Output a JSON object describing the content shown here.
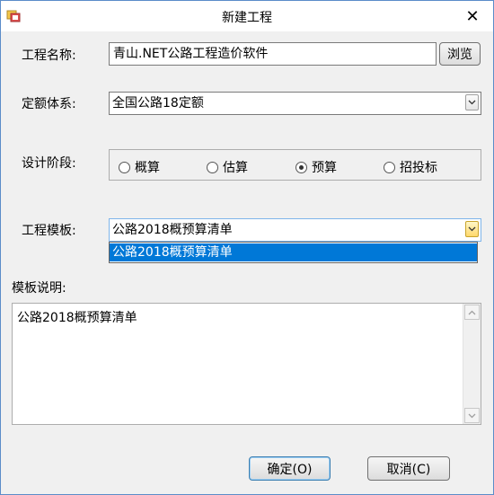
{
  "window": {
    "title": "新建工程",
    "close_glyph": "✕"
  },
  "project_name": {
    "label": "工程名称:",
    "value": "青山.NET公路工程造价软件",
    "browse_label": "浏览"
  },
  "quota_system": {
    "label": "定额体系:",
    "value": "全国公路18定额"
  },
  "design_stage": {
    "label": "设计阶段:",
    "options": [
      "概算",
      "估算",
      "预算",
      "招投标"
    ],
    "selected": "预算"
  },
  "template": {
    "label": "工程模板:",
    "value": "公路2018概预算清单",
    "dropdown_items": [
      "公路2018概预算清单"
    ]
  },
  "template_desc": {
    "label": "模板说明:",
    "text": "公路2018概预算清单"
  },
  "buttons": {
    "ok_label": "确定(O)",
    "cancel_label": "取消(C)"
  },
  "icons": {
    "app": "app-window-icon",
    "close": "close-icon",
    "combo_arrow": "chevron-down-icon",
    "scroll_up": "scroll-up-icon",
    "scroll_down": "scroll-down-icon"
  }
}
